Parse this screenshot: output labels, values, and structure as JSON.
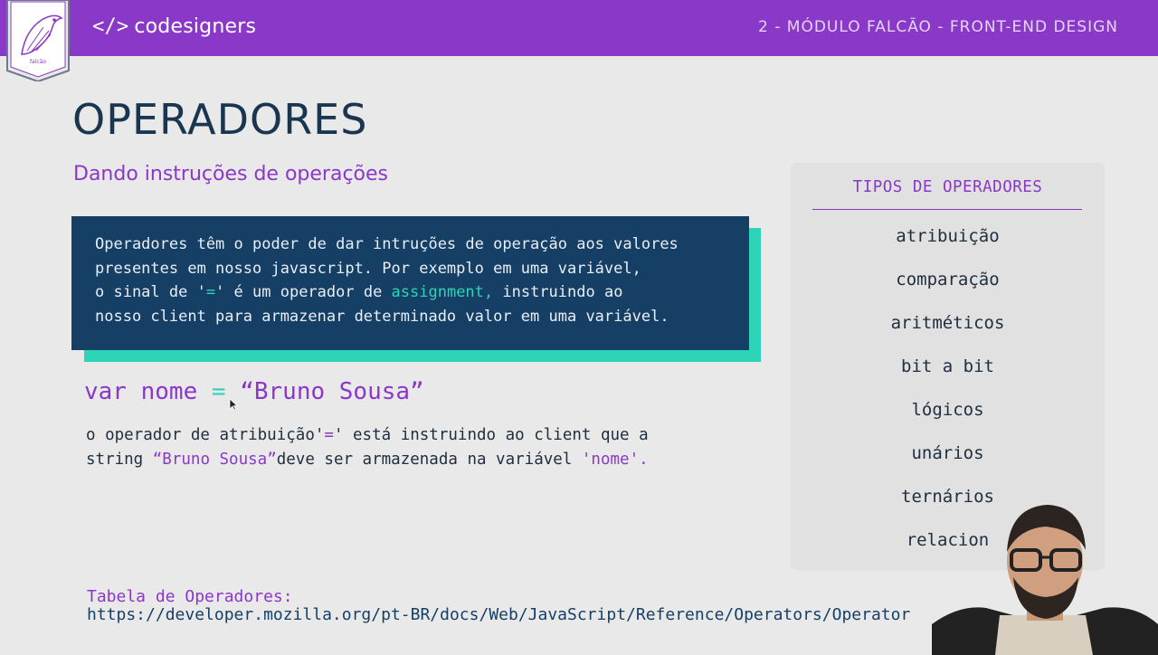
{
  "header": {
    "brand": "codesigners",
    "brand_icon": "</>",
    "module": "2 - MÓDULO FALCÃO - FRONT-END DESIGN"
  },
  "slide": {
    "title": "OPERADORES",
    "subtitle": "Dando instruções de operações",
    "box": {
      "line1": "Operadores têm o poder de dar intruções de operação aos valores",
      "line2": "presentes em nosso javascript. Por exemplo em uma variável,",
      "line3_a": "o sinal de '",
      "line3_eq": "=",
      "line3_b": "' é um operador de ",
      "line3_hl": "assignment,",
      "line3_c": " instruindo ao",
      "line4": "nosso client para armazenar determinado valor em uma variável."
    },
    "code": {
      "left": "var nome ",
      "op": "=",
      "right": "  “Bruno Sousa”"
    },
    "desc": {
      "a": "o operador de atribuição'",
      "eq": "=",
      "b": "' está instruindo ao client que a",
      "c": "string ",
      "hl1": "“Bruno Sousa”",
      "d": "deve ser armazenada na variável ",
      "hl2": "'nome'."
    },
    "reference": {
      "label": "Tabela de Operadores:",
      "url": "https://developer.mozilla.org/pt-BR/docs/Web/JavaScript/Reference/Operators/Operator"
    }
  },
  "panel": {
    "title": "TIPOS DE OPERADORES",
    "items": [
      "atribuição",
      "comparação",
      "aritméticos",
      "bit a bit",
      "lógicos",
      "unários",
      "ternários",
      "relacion"
    ]
  },
  "colors": {
    "purple": "#8a38c8",
    "navy": "#163f66",
    "teal": "#2dd4b8"
  }
}
